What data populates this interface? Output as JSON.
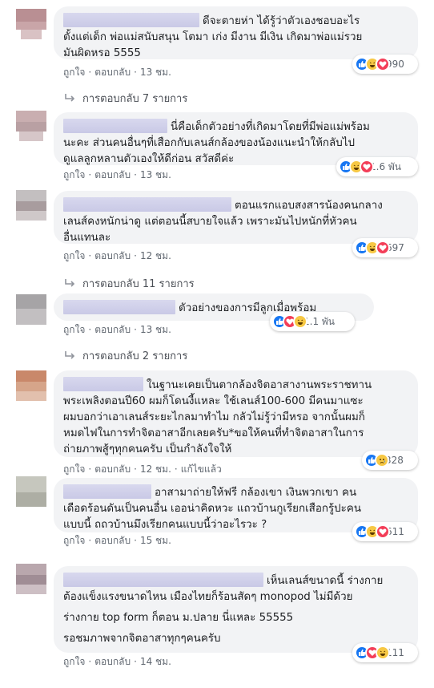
{
  "labels": {
    "like": "ถูกใจ",
    "reply": "ตอบกลับ",
    "edited": "แก้ไขแล้ว"
  },
  "colors": {
    "bubble": "#f2f3f5",
    "redact": "#c9c9e6",
    "like_blue": "#1877f2",
    "love_red": "#f33e58",
    "haha_yellow": "#f7c844"
  },
  "comments": [
    {
      "lines": [
        "ดีจะตายห่า ได้รู้ว่าตัวเองชอบอะไร",
        "ตั้งแต่เด็ก พ่อแม่สนับสนุน โตมา เก่ง มีงาน มีเงิน เกิดมาพ่อแม่รวย",
        "มันผิดหรอ 5555"
      ],
      "time": "13 ชม.",
      "reactions": [
        "like-icon",
        "haha-icon",
        "love-icon"
      ],
      "reaction_count": "990",
      "replies": "การตอบกลับ 7 รายการ"
    },
    {
      "lines": [
        "นี่คือเด็กตัวอย่างที่เกิดมาโดยที่มีพ่อแม่พร้อม",
        "นะคะ ส่วนคนอื่นๆที่เสือกกับเลนส์กล้องของน้องแนะนำให้กลับไป",
        "ดูแลลูกหลานตัวเองให้ดีก่อน สวัสดีค่ะ"
      ],
      "time": "13 ชม.",
      "reactions": [
        "like-icon",
        "haha-icon",
        "love-icon"
      ],
      "reaction_count": "1.6 พัน"
    },
    {
      "lines": [
        "ตอนแรกแอบสงสารน้องคนกลาง",
        "เลนส์คงหนักน่าดู แต่ตอนนี้สบายใจแล้ว เพราะมันไปหนักที่หัวคน",
        "อื่นแทนละ"
      ],
      "time": "12 ชม.",
      "reactions": [
        "like-icon",
        "haha-icon",
        "love-icon"
      ],
      "reaction_count": "697",
      "replies": "การตอบกลับ 11 รายการ"
    },
    {
      "lines": [
        "ตัวอย่างของการมีลูกเมื่อพร้อม"
      ],
      "time": "13 ชม.",
      "reactions": [
        "like-icon",
        "love-icon",
        "haha-icon"
      ],
      "reaction_count": "1.1 พัน",
      "replies": "การตอบกลับ 2 รายการ"
    },
    {
      "lines": [
        "ในฐานะเคยเป็นตากล้องจิตอาสางานพระราชทาน",
        "พระเพลิงตอนปี60 ผมก็โดนงี้แหละ ใช้เลนส์100-600 มีคนมาแซะ",
        "ผมบอกว่าเอาเลนส์ระยะไกลมาทำไม กลัวไม่รู้ว่ามีหรอ จากนั้นผมก็",
        "หมดไฟในการทำจิตอาสาอีกเลยครับ*ขอให้คนที่ทำจิตอาสาในการ",
        "ถ่ายภาพสู้ๆทุกคนครับ เป็นกำลังใจให้"
      ],
      "time": "12 ชม.",
      "edited": true,
      "reactions": [
        "like-icon",
        "sad-icon"
      ],
      "reaction_count": "328"
    },
    {
      "lines": [
        "อาสามาถ่ายให้ฟรี กล้องเขา เงินพวกเขา คน",
        "เดือดร้อนดันเป็นคนอื่น เออน่าคิดหวะ แถวบ้านกูเรียกเสือกรู้ปะคน",
        "แบบนี้ ถถวบ้านมึงเรียกคนแบบนี้ว่าอะไรวะ ?"
      ],
      "time": "15 ชม.",
      "reactions": [
        "like-icon",
        "haha-icon",
        "love-icon"
      ],
      "reaction_count": "611"
    },
    {
      "lines": [
        "เห็นเลนส์ขนาดนี้ ร่างกาย",
        "ต้องแข็งแรงขนาดไหน เมืองไทยก็ร้อนสัดๆ monopod ไม่มีด้วย",
        "",
        "ร่างกาย top form ก็ตอน ม.ปลาย นี่แหละ 55555",
        "",
        "รอชมภาพจากจิตอาสาทุกๆคนครับ"
      ],
      "time": "14 ชม.",
      "reactions": [
        "like-icon",
        "love-icon",
        "haha-icon"
      ],
      "reaction_count": "111"
    }
  ]
}
